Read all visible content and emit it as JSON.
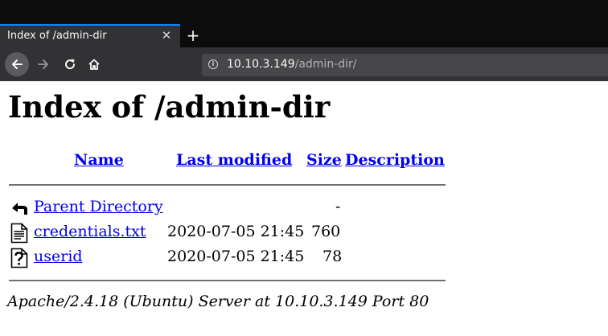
{
  "browser": {
    "tab": {
      "title": "Index of /admin-dir",
      "close_glyph": "✕"
    },
    "new_tab_glyph": "+",
    "nav": {
      "back_icon": "arrow-left-icon",
      "forward_icon": "arrow-right-icon",
      "reload_icon": "reload-icon",
      "home_icon": "home-icon"
    },
    "url": {
      "info_glyph": "i",
      "host": "10.10.3.149",
      "path": "/admin-dir/"
    },
    "colors": {
      "chrome": "#0c0c0d",
      "toolbar": "#323234",
      "urlbar": "#474749",
      "tab_accent": "#0a84ff"
    }
  },
  "page": {
    "title": "Index of /admin-dir",
    "columns": {
      "name": "Name",
      "last_modified": "Last modified",
      "size": "Size",
      "description": "Description"
    },
    "rows": [
      {
        "icon": "parent-directory-icon",
        "name": "Parent Directory",
        "modified": "",
        "size": "-",
        "description": ""
      },
      {
        "icon": "text-file-icon",
        "name": "credentials.txt",
        "modified": "2020-07-05 21:45",
        "size": "760",
        "description": ""
      },
      {
        "icon": "unknown-file-icon",
        "name": "userid",
        "modified": "2020-07-05 21:45",
        "size": "78",
        "description": ""
      }
    ],
    "address": "Apache/2.4.18 (Ubuntu) Server at 10.10.3.149 Port 80",
    "colors": {
      "link": "#0000ee",
      "rule": "#707070"
    }
  }
}
